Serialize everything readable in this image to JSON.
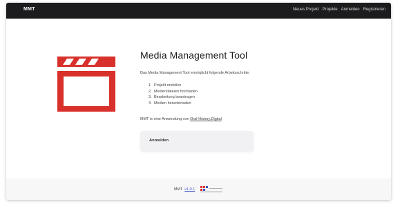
{
  "navbar": {
    "brand": "MMT",
    "links": [
      "Neues Projekt",
      "Projekte",
      "Anmelden",
      "Registrieren"
    ]
  },
  "main": {
    "title": "Media Management Tool",
    "intro": "Das Media Management Tool ermöglicht folgende Arbeitsschritte:",
    "steps": [
      {
        "num": "1.",
        "text": "Projekt erstellen"
      },
      {
        "num": "2.",
        "text": "Mediendateien hochladen"
      },
      {
        "num": "3.",
        "text": "Bearbeitung beantragen"
      },
      {
        "num": "4.",
        "text": "Medien herunterladen"
      }
    ],
    "note_prefix": "MMT is eine Anwendung von ",
    "note_link": "Oral-History.Digital",
    "login_label": "Anmelden"
  },
  "footer": {
    "brand": "MMT",
    "version": "v1.0.1"
  },
  "colors": {
    "logo_red": "#d8302b",
    "navbar_bg": "#1c1c1e",
    "link_blue": "#3a56c5"
  },
  "icons": {
    "logo": "clapperboard-icon",
    "footer_logo": "institution-logo-icon"
  }
}
